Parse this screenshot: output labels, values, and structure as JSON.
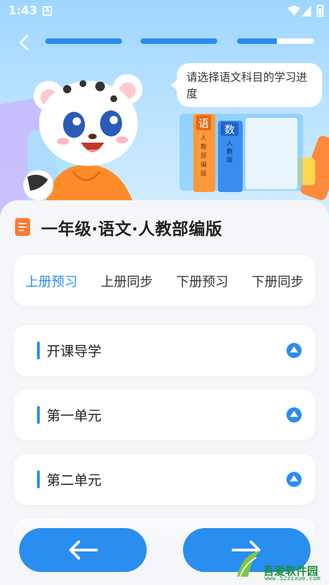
{
  "status_bar": {
    "time": "1:43",
    "notification_icon_letter": "A"
  },
  "header": {
    "progress_steps": [
      {
        "completed": 1.0
      },
      {
        "completed": 1.0
      },
      {
        "completed": 0.52
      }
    ],
    "prompt": "请选择语文科目的学习进度",
    "book_labels": [
      "语",
      "人",
      "教",
      "部",
      "编",
      "版",
      "数",
      "人",
      "教",
      "版"
    ]
  },
  "course": {
    "title": "一年级·语文·人教部编版"
  },
  "tabs": [
    {
      "label": "上册预习",
      "active": true
    },
    {
      "label": "上册同步",
      "active": false
    },
    {
      "label": "下册预习",
      "active": false
    },
    {
      "label": "下册同步",
      "active": false
    }
  ],
  "units": [
    {
      "label": "开课导学"
    },
    {
      "label": "第一单元"
    },
    {
      "label": "第二单元"
    }
  ],
  "watermark": {
    "text": "吾爱软件园",
    "url": "www.52zixue.com"
  },
  "colors": {
    "accent": "#2a8df0",
    "doc_icon": "#ff7a2e",
    "sheet_bg": "#f4f6f9"
  },
  "icons": {
    "back": "chevron-left-icon",
    "doc": "document-icon",
    "unit_toggle": "triangle-up-circle-icon",
    "prev": "arrow-left-icon",
    "next": "arrow-right-icon"
  }
}
